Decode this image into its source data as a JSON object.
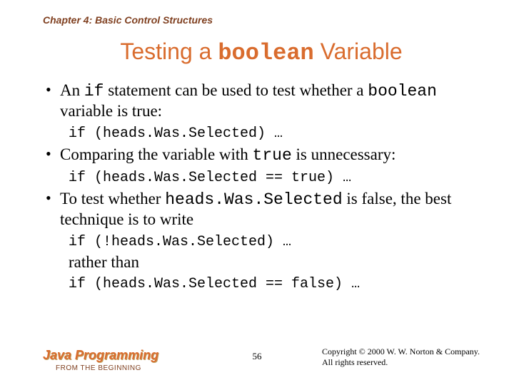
{
  "chapter": "Chapter 4: Basic Control Structures",
  "title_prefix": "Testing a ",
  "title_code": "boolean",
  "title_suffix": " Variable",
  "bullets": {
    "b1_a": "An ",
    "b1_code": "if",
    "b1_b": " statement can be used to test whether a ",
    "b1_code2": "boolean",
    "b1_c": " variable is true:",
    "code1": "if (heads.Was.Selected) …",
    "b2_a": "Comparing the variable with ",
    "b2_code": "true",
    "b2_b": " is unnecessary:",
    "code2": "if (heads.Was.Selected == true) …",
    "b3_a": "To test whether ",
    "b3_code": "heads.Was.Selected",
    "b3_b": " is false, the best technique is to write",
    "code3": "if (!heads.Was.Selected) …",
    "rather": "rather than",
    "code4": "if (heads.Was.Selected == false) …"
  },
  "footer": {
    "brand": "Java Programming",
    "sub": "FROM THE BEGINNING",
    "page": "56",
    "copy1": "Copyright © 2000 W. W. Norton & Company.",
    "copy2": "All rights reserved."
  }
}
